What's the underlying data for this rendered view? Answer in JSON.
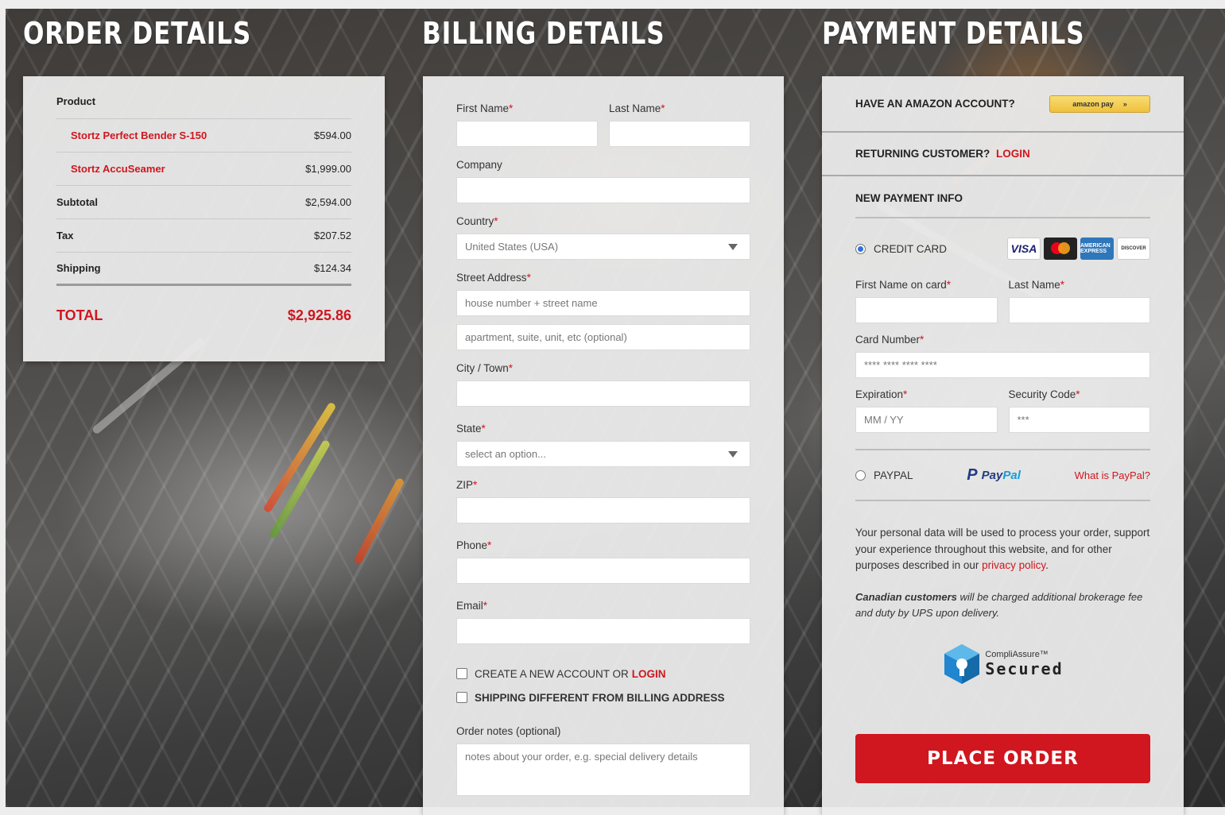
{
  "headings": {
    "order": "ORDER DETAILS",
    "billing": "BILLING DETAILS",
    "payment": "PAYMENT DETAILS"
  },
  "order": {
    "product_header": "Product",
    "items": [
      {
        "name": "Stortz Perfect Bender S-150",
        "price": "$594.00"
      },
      {
        "name": "Stortz AccuSeamer",
        "price": "$1,999.00"
      }
    ],
    "subtotal_label": "Subtotal",
    "subtotal": "$2,594.00",
    "tax_label": "Tax",
    "tax": "$207.52",
    "shipping_label": "Shipping",
    "shipping": "$124.34",
    "total_label": "TOTAL",
    "total": "$2,925.86"
  },
  "billing": {
    "required_mark": "*",
    "first_name_label": "First Name",
    "last_name_label": "Last Name",
    "company_label": "Company",
    "country_label": "Country",
    "country_value": "United States (USA)",
    "street_label": "Street Address",
    "street_placeholder": "house number + street name",
    "street2_placeholder": "apartment, suite, unit, etc (optional)",
    "city_label": "City / Town",
    "state_label": "State",
    "state_value": "select an option...",
    "zip_label": "ZIP",
    "phone_label": "Phone",
    "email_label": "Email",
    "create_account_text": "CREATE A NEW ACCOUNT OR",
    "create_account_login": "LOGIN",
    "ship_different_text": "SHIPPING DIFFERENT FROM BILLING ADDRESS",
    "notes_label": "Order notes (optional)",
    "notes_placeholder": "notes about your order, e.g. special delivery details"
  },
  "payment": {
    "amazon_question": "HAVE AN AMAZON ACCOUNT?",
    "amazon_button": "amazon pay",
    "amazon_button_arrow": "»",
    "returning_text": "RETURNING CUSTOMER?",
    "returning_login": "LOGIN",
    "new_payment_info": "NEW PAYMENT INFO",
    "credit_card_label": "CREDIT CARD",
    "card_visa": "VISA",
    "card_amex": "AMERICAN EXPRESS",
    "card_discover": "DISCOVER",
    "first_name_card_label": "First Name on card",
    "last_name_label": "Last Name",
    "card_number_label": "Card Number",
    "card_number_placeholder": "**** **** **** ****",
    "expiration_label": "Expiration",
    "expiration_placeholder": "MM / YY",
    "security_label": "Security Code",
    "security_placeholder": "***",
    "paypal_label": "PAYPAL",
    "paypal_logo_pay": "Pay",
    "paypal_logo_pal": "Pal",
    "paypal_icon": "P",
    "what_is_paypal": "What is PayPal?",
    "privacy_text": "Your personal data will be used to process your order, support your experience throughout this website, and for other purposes described in our",
    "privacy_link": "privacy policy",
    "privacy_end": ".",
    "canada_bold": "Canadian customers",
    "canada_text": "will be charged additional brokerage fee and duty by UPS upon delivery.",
    "seal_top": "CompliAssure™",
    "seal_bottom": "Secured",
    "place_order": "PLACE ORDER"
  },
  "colors": {
    "accent_red": "#d0161f",
    "radio_blue": "#2f6fe0",
    "amazon_yellow": "#efc13b"
  }
}
